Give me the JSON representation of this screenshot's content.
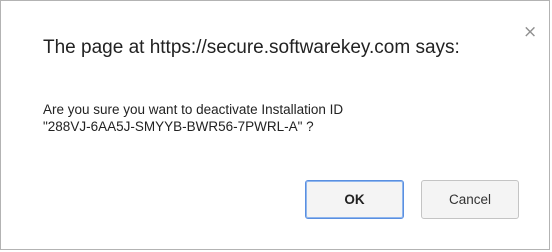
{
  "dialog": {
    "title": "The page at https://secure.softwarekey.com says:",
    "close_glyph": "×",
    "message_line1": "Are you sure you want to deactivate Installation ID",
    "message_line2": "\"288VJ-6AA5J-SMYYB-BWR56-7PWRL-A\" ?",
    "ok_label": "OK",
    "cancel_label": "Cancel"
  },
  "colors": {
    "border": "#b3b3b3",
    "ok_focus_ring": "#5a8fe0",
    "button_bg": "#f4f4f4",
    "text": "#222222"
  },
  "icons": {
    "close": "close-icon"
  }
}
